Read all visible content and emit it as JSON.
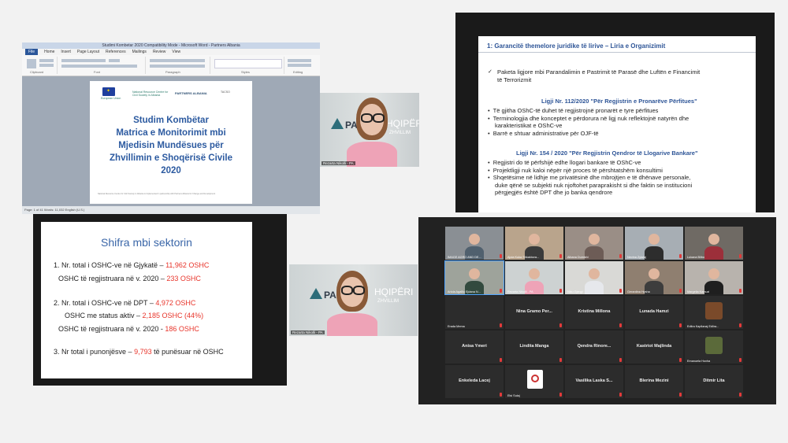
{
  "word": {
    "window_title": "Studimi Kombetar 2020 Compatibility Mode - Microsoft Word - Partners Albania",
    "tabs": [
      "File",
      "Home",
      "Insert",
      "Page Layout",
      "References",
      "Mailings",
      "Review",
      "View"
    ],
    "ribbon_groups": [
      "Clipboard",
      "Font",
      "Paragraph",
      "Styles",
      "Editing"
    ],
    "logos": [
      "European Union",
      "National Resource Centre for Civil Society in Albania",
      "PARTNERS ALBANIA",
      "TACSO"
    ],
    "doc_title_lines": [
      "Studim Kombëtar",
      "Matrica e Monitorimit mbi",
      "Mjedisin Mundësues për",
      "Zhvillimin e Shoqërisë Civile",
      "2020"
    ],
    "footer_text": "National Resource Centre for Civil Society in Albania is implemented in partnership with Partners Albania for Change and Development",
    "status_bar": "Page: 1 of 41   Words: 11,032   English (U.S.)",
    "status_icons": [
      "page-icon",
      "proofing-icon",
      "zoom-slider-icon"
    ]
  },
  "camera_1": {
    "logo_text": "PAR",
    "logo_text2": "HQIPËRI",
    "logo_sub": "ZHVILLIM",
    "participant_name": "Rezarta Nikolli - PA"
  },
  "camera_2": {
    "logo_text": "PAR",
    "logo_text2": "HQIPËRI",
    "logo_sub": "ZHVILLIM",
    "participant_name": "Rezarta Nikolli - PA"
  },
  "slide_legal": {
    "heading": "1: Garancitë themelore juridike të lirive – Liria e Organizimit",
    "intro_bullet": "✓",
    "intro_lines": [
      "Paketa ligjore mbi Parandalimin  e Pastrimit  të Parasë  dhe Luftën e Financimit",
      "të Terrorizmit"
    ],
    "law1_title": "Ligji Nr. 112/2020  \"Për Regjistrin e Pronarëve Përfitues\"",
    "law1_bullets": [
      "Të gjitha OShC-të duhet të regjistrojnë pronarët e tyre përfitues",
      "Terminologjia dhe konceptet e përdorura në ligj nuk reflektojnë natyrën dhe",
      "karakteristikat e OShC-ve",
      "Barrë e shtuar administrative për OJF-të"
    ],
    "law2_title": "Ligji Nr. 154 / 2020  \"Për Regjistrin Qendror të Llogarive Bankare\"",
    "law2_bullets": [
      "Regjistri do të përfshijë edhe llogari bankare të OShC-ve",
      "Projektligji nuk kaloi nëpër një proces të përshtatshëm konsultimi",
      "Shqetësime në lidhje me privatësinë dhe mbrojtjen e të dhënave personale,",
      "duke qënë se subjekti nuk njoftohet paraprakisht si dhe faktin se institucioni",
      "përgjegjës është DPT dhe jo banka qendrore"
    ]
  },
  "slide_numbers": {
    "title": "Shifra mbi sektorin",
    "l1a": "1.  Nr. total i OSHC-ve në Gjykatë  – ",
    "l1a_val": "11,962 OSHC",
    "l1b": "OSHC të regjistruara në v. 2020 – ",
    "l1b_val": "233 OSHC",
    "l2a": "2.  Nr. total i OSHC-ve në DPT  – ",
    "l2a_val": "4,972 OSHC",
    "l2b": "OSHC me status aktiv – ",
    "l2b_val": "2,185 OSHC (44%)",
    "l2c": "OSHC të regjistruara në v. 2020 - ",
    "l2c_val": "186 OSHC",
    "l3": "3.  Nr total i punonjësve – ",
    "l3_val": "9,793",
    "l3_tail": " të punësuar në OSHC"
  },
  "gallery": {
    "video_tiles": [
      "IMAGE AGRO AND DE...",
      "Ajola Kuka Shkaktova...",
      "Albana Dumishi",
      "Nevina Zylalaj",
      "Lukana Bilbo",
      "Ariola Agalliu Ejdana N...",
      "Rezarta Nikolli - PA",
      "Niku Gjergji",
      "Gerardina Hysha",
      "Margelia Kamuzi"
    ],
    "name_tiles": [
      "Nina Gramo Per...",
      "Kristina Millona",
      "Lunada Hamzi",
      "Anisa Ymeri",
      "Lindita Manga",
      "Qendra Rinore...",
      "Kastriot Majlinda",
      "Enkeleda Lacej",
      "Vasilika Laska S...",
      "Blerina Mezini",
      "Ditmir Lita"
    ],
    "small_labels": [
      "Erada Mema",
      "Edlira Kapllanaj Edlira...",
      "Emanuela Hoxha",
      "Elsi Sulaj"
    ]
  }
}
